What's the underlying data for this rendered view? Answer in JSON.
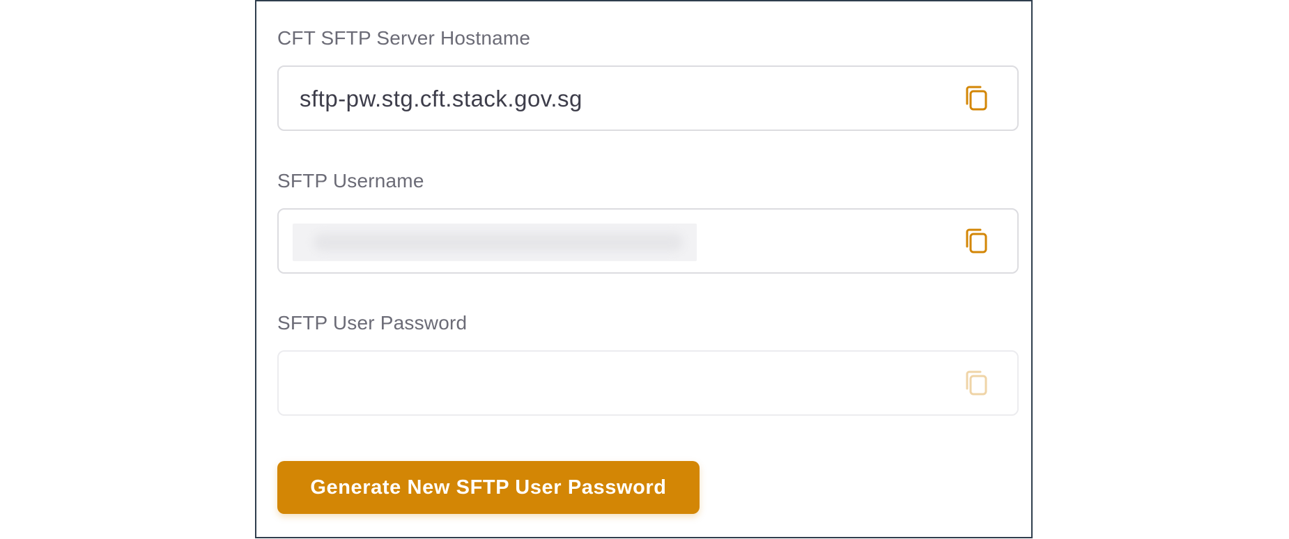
{
  "fields": [
    {
      "label": "CFT SFTP Server Hostname",
      "value": "sftp-pw.stg.cft.stack.gov.sg",
      "copy_icon": "copy-icon",
      "state": "enabled"
    },
    {
      "label": "SFTP Username",
      "value": "",
      "redacted": true,
      "copy_icon": "copy-icon",
      "state": "enabled"
    },
    {
      "label": "SFTP User Password",
      "value": "",
      "copy_icon": "copy-icon",
      "state": "disabled"
    }
  ],
  "actions": {
    "generate_label": "Generate New SFTP User Password"
  },
  "colors": {
    "accent": "#d38605",
    "label_text": "#6b6b76",
    "value_text": "#3d3d4a",
    "panel_border": "#2f3e4d",
    "field_border": "#dcdce0"
  }
}
